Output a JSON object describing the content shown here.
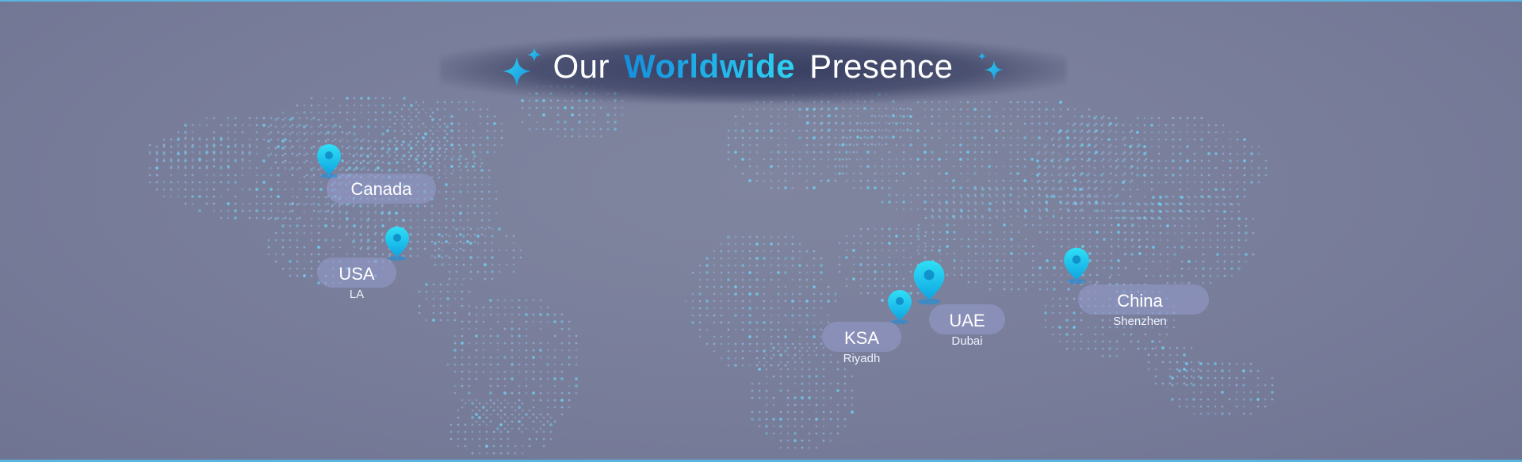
{
  "header": {
    "title_prefix": "Our",
    "title_highlight": "Worldwide",
    "title_suffix": "Presence"
  },
  "colors": {
    "background": "#7a809e",
    "accent": "#1aa6e8",
    "pin": "#16c2ee",
    "dots": "#8fc8f0"
  },
  "locations": [
    {
      "country": "Canada",
      "city": ""
    },
    {
      "country": "USA",
      "city": "LA"
    },
    {
      "country": "KSA",
      "city": "Riyadh"
    },
    {
      "country": "UAE",
      "city": "Dubai"
    },
    {
      "country": "China",
      "city": "Shenzhen"
    }
  ]
}
